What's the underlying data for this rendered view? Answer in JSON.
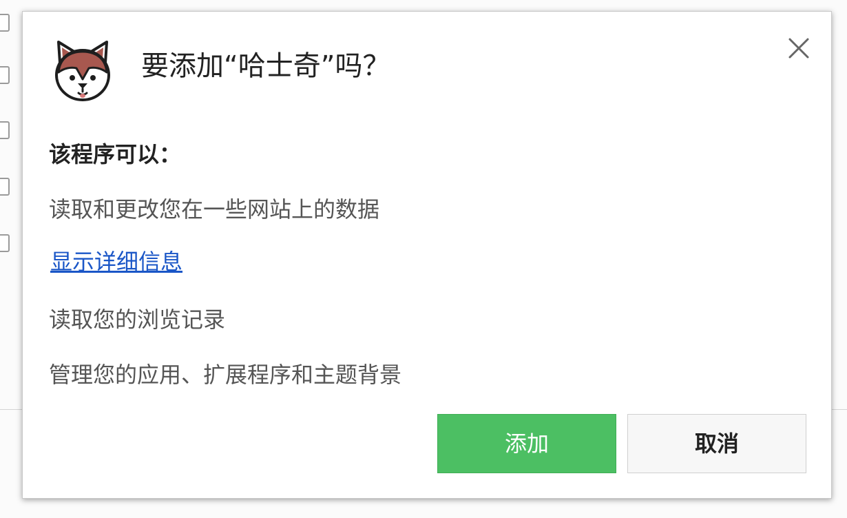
{
  "dialog": {
    "title": "要添加“哈士奇”吗？",
    "extension_icon": "husky-dog-icon",
    "close_icon": "close-icon",
    "section_heading": "该程序可以：",
    "permissions": [
      "读取和更改您在一些网站上的数据",
      "读取您的浏览记录",
      "管理您的应用、扩展程序和主题背景"
    ],
    "details_link": "显示详细信息",
    "add_button": "添加",
    "cancel_button": "取消"
  },
  "colors": {
    "add_button_bg": "#4cbf63",
    "link": "#1a56c7"
  }
}
